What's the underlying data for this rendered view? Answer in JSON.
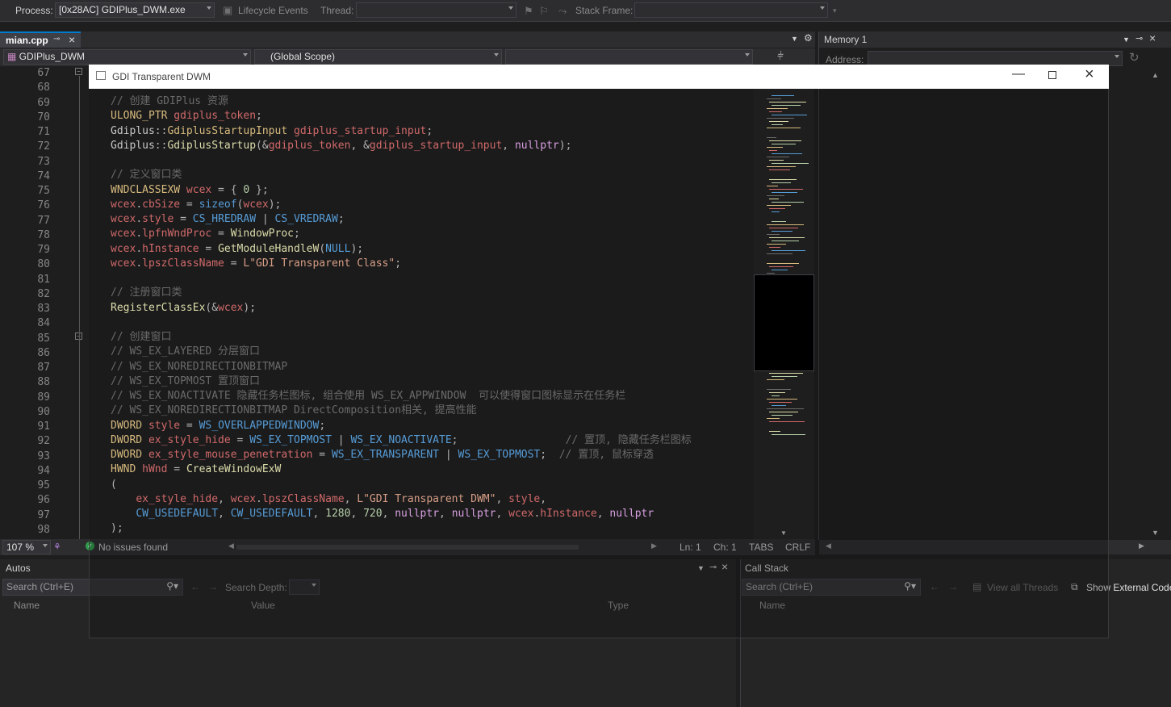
{
  "toolbar": {
    "process_label": "Process:",
    "process_value": "[0x28AC] GDIPlus_DWM.exe",
    "lifecycle_label": "Lifecycle Events",
    "thread_label": "Thread:",
    "stack_frame_label": "Stack Frame:"
  },
  "editor": {
    "tab_label": "mian.cpp",
    "project_combo": "GDIPlus_DWM",
    "scope_combo": "(Global Scope)",
    "zoom": "107 %",
    "issues": "No issues found",
    "ln": "Ln: 1",
    "ch": "Ch: 1",
    "tabs": "TABS",
    "eol": "CRLF",
    "line_numbers": [
      "67",
      "68",
      "69",
      "70",
      "71",
      "72",
      "73",
      "74",
      "75",
      "76",
      "77",
      "78",
      "79",
      "80",
      "81",
      "82",
      "83",
      "84",
      "85",
      "86",
      "87",
      "88",
      "89",
      "90",
      "91",
      "92",
      "93",
      "94",
      "95",
      "96",
      "97",
      "98"
    ]
  },
  "memory": {
    "title": "Memory 1",
    "address_label": "Address:"
  },
  "autos": {
    "title": "Autos",
    "search_placeholder": "Search (Ctrl+E)",
    "search_depth": "Search Depth:",
    "col_name": "Name",
    "col_value": "Value",
    "col_type": "Type"
  },
  "callstack": {
    "title": "Call Stack",
    "search_placeholder": "Search (Ctrl+E)",
    "view_all_threads": "View all Threads",
    "show_external": "Show External Code",
    "col_name": "Name"
  },
  "overlay": {
    "title": "GDI Transparent DWM",
    "code": [
      [
        [
          "c-cmd",
          "// 创建 GDIPlus 资源"
        ]
      ],
      [
        [
          "c-ty",
          "ULONG_PTR "
        ],
        [
          "c-var",
          "gdiplus_token"
        ],
        [
          "c-op",
          ";"
        ]
      ],
      [
        [
          "c-ns",
          "Gdiplus"
        ],
        [
          "c-op",
          "::"
        ],
        [
          "c-ty",
          "GdiplusStartupInput "
        ],
        [
          "c-var",
          "gdiplus_startup_input"
        ],
        [
          "c-op",
          ";"
        ]
      ],
      [
        [
          "c-ns",
          "Gdiplus"
        ],
        [
          "c-op",
          "::"
        ],
        [
          "c-fn",
          "GdiplusStartup"
        ],
        [
          "c-op",
          "(&"
        ],
        [
          "c-var",
          "gdiplus_token"
        ],
        [
          "c-op",
          ", &"
        ],
        [
          "c-var",
          "gdiplus_startup_input"
        ],
        [
          "c-op",
          ", "
        ],
        [
          "c-kw2",
          "nullptr"
        ],
        [
          "c-op",
          ");"
        ]
      ],
      [],
      [
        [
          "c-cmd",
          "// 定义窗口类"
        ]
      ],
      [
        [
          "c-ty",
          "WNDCLASSEXW "
        ],
        [
          "c-var",
          "wcex"
        ],
        [
          "c-op",
          " = { "
        ],
        [
          "c-num",
          "0"
        ],
        [
          "c-op",
          " };"
        ]
      ],
      [
        [
          "c-var",
          "wcex"
        ],
        [
          "c-op",
          "."
        ],
        [
          "c-mem",
          "cbSize"
        ],
        [
          "c-op",
          " = "
        ],
        [
          "c-kw",
          "sizeof"
        ],
        [
          "c-op",
          "("
        ],
        [
          "c-var",
          "wcex"
        ],
        [
          "c-op",
          ");"
        ]
      ],
      [
        [
          "c-var",
          "wcex"
        ],
        [
          "c-op",
          "."
        ],
        [
          "c-mem",
          "style"
        ],
        [
          "c-op",
          " = "
        ],
        [
          "c-mac",
          "CS_HREDRAW"
        ],
        [
          "c-op",
          " | "
        ],
        [
          "c-mac",
          "CS_VREDRAW"
        ],
        [
          "c-op",
          ";"
        ]
      ],
      [
        [
          "c-var",
          "wcex"
        ],
        [
          "c-op",
          "."
        ],
        [
          "c-mem",
          "lpfnWndProc"
        ],
        [
          "c-op",
          " = "
        ],
        [
          "c-fn",
          "WindowProc"
        ],
        [
          "c-op",
          ";"
        ]
      ],
      [
        [
          "c-var",
          "wcex"
        ],
        [
          "c-op",
          "."
        ],
        [
          "c-mem",
          "hInstance"
        ],
        [
          "c-op",
          " = "
        ],
        [
          "c-fn",
          "GetModuleHandleW"
        ],
        [
          "c-op",
          "("
        ],
        [
          "c-mac",
          "NULL"
        ],
        [
          "c-op",
          ");"
        ]
      ],
      [
        [
          "c-var",
          "wcex"
        ],
        [
          "c-op",
          "."
        ],
        [
          "c-mem",
          "lpszClassName"
        ],
        [
          "c-op",
          " = "
        ],
        [
          "c-str",
          "L\"GDI Transparent Class\""
        ],
        [
          "c-op",
          ";"
        ]
      ],
      [],
      [
        [
          "c-cmd",
          "// 注册窗口类"
        ]
      ],
      [
        [
          "c-fn",
          "RegisterClassEx"
        ],
        [
          "c-op",
          "(&"
        ],
        [
          "c-var",
          "wcex"
        ],
        [
          "c-op",
          ");"
        ]
      ],
      [],
      [
        [
          "c-cmd",
          "// 创建窗口"
        ]
      ],
      [
        [
          "c-cmd",
          "// WS_EX_LAYERED 分层窗口"
        ]
      ],
      [
        [
          "c-cmd",
          "// WS_EX_NOREDIRECTIONBITMAP"
        ]
      ],
      [
        [
          "c-cmd",
          "// WS_EX_TOPMOST 置顶窗口"
        ]
      ],
      [
        [
          "c-cmd",
          "// WS_EX_NOACTIVATE 隐藏任务栏图标, 组合使用 WS_EX_APPWINDOW  可以使得窗口图标显示在任务栏"
        ]
      ],
      [
        [
          "c-cmd",
          "// WS_EX_NOREDIRECTIONBITMAP DirectComposition相关, 提高性能"
        ]
      ],
      [
        [
          "c-ty",
          "DWORD "
        ],
        [
          "c-var",
          "style"
        ],
        [
          "c-op",
          " = "
        ],
        [
          "c-mac",
          "WS_OVERLAPPEDWINDOW"
        ],
        [
          "c-op",
          ";"
        ]
      ],
      [
        [
          "c-ty",
          "DWORD "
        ],
        [
          "c-var",
          "ex_style_hide"
        ],
        [
          "c-op",
          " = "
        ],
        [
          "c-mac",
          "WS_EX_TOPMOST"
        ],
        [
          "c-op",
          " | "
        ],
        [
          "c-mac",
          "WS_EX_NOACTIVATE"
        ],
        [
          "c-op",
          ";                 "
        ],
        [
          "c-cmd",
          "// 置顶, 隐藏任务栏图标"
        ]
      ],
      [
        [
          "c-ty",
          "DWORD "
        ],
        [
          "c-var",
          "ex_style_mouse_penetration"
        ],
        [
          "c-op",
          " = "
        ],
        [
          "c-mac",
          "WS_EX_TRANSPARENT"
        ],
        [
          "c-op",
          " | "
        ],
        [
          "c-mac",
          "WS_EX_TOPMOST"
        ],
        [
          "c-op",
          ";  "
        ],
        [
          "c-cmd",
          "// 置顶, 鼠标穿透"
        ]
      ],
      [
        [
          "c-ty",
          "HWND "
        ],
        [
          "c-var",
          "hWnd"
        ],
        [
          "c-op",
          " = "
        ],
        [
          "c-fn",
          "CreateWindowExW"
        ]
      ],
      [
        [
          "c-op",
          "("
        ]
      ],
      [
        [
          "c-op",
          "    "
        ],
        [
          "c-var",
          "ex_style_hide"
        ],
        [
          "c-op",
          ", "
        ],
        [
          "c-var",
          "wcex"
        ],
        [
          "c-op",
          "."
        ],
        [
          "c-mem",
          "lpszClassName"
        ],
        [
          "c-op",
          ", "
        ],
        [
          "c-str",
          "L\"GDI Transparent DWM\""
        ],
        [
          "c-op",
          ", "
        ],
        [
          "c-var",
          "style"
        ],
        [
          "c-op",
          ","
        ]
      ],
      [
        [
          "c-op",
          "    "
        ],
        [
          "c-mac",
          "CW_USEDEFAULT"
        ],
        [
          "c-op",
          ", "
        ],
        [
          "c-mac",
          "CW_USEDEFAULT"
        ],
        [
          "c-op",
          ", "
        ],
        [
          "c-num",
          "1280"
        ],
        [
          "c-op",
          ", "
        ],
        [
          "c-num",
          "720"
        ],
        [
          "c-op",
          ", "
        ],
        [
          "c-kw2",
          "nullptr"
        ],
        [
          "c-op",
          ", "
        ],
        [
          "c-kw2",
          "nullptr"
        ],
        [
          "c-op",
          ", "
        ],
        [
          "c-var",
          "wcex"
        ],
        [
          "c-op",
          "."
        ],
        [
          "c-mem",
          "hInstance"
        ],
        [
          "c-op",
          ", "
        ],
        [
          "c-kw2",
          "nullptr"
        ]
      ],
      [
        [
          "c-op",
          ");"
        ]
      ]
    ]
  }
}
